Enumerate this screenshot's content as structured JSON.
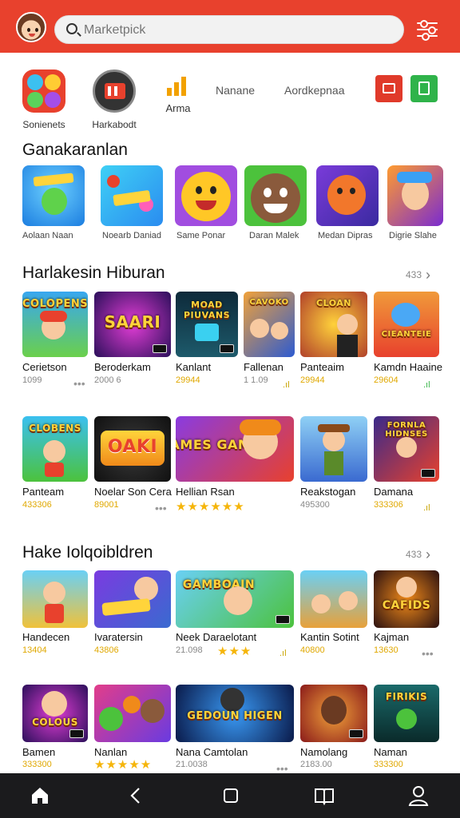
{
  "header": {
    "search_placeholder": "Marketpick"
  },
  "quick": {
    "cat1_label": "Sonienets",
    "cat2_label": "Harkabodt",
    "cat3_label": "Arma",
    "link1": "Nanane",
    "link2": "Aordkepnaa"
  },
  "favorites": {
    "title": "Ganakaranlan",
    "items": [
      {
        "label": "Aolaan Naan"
      },
      {
        "label": "Noearb Daniad"
      },
      {
        "label": "Same Ponar"
      },
      {
        "label": "Daran Malek"
      },
      {
        "label": "Medan Dipras"
      },
      {
        "label": "Digrie Slahe"
      }
    ]
  },
  "section1": {
    "title": "Harlakesin Hiburan",
    "more": "433",
    "row1": [
      {
        "name": "Cerietson",
        "meta": "1099"
      },
      {
        "name": "Beroderkam",
        "meta": "2000 6"
      },
      {
        "name": "Kanlant",
        "meta": "29944"
      },
      {
        "name": "Fallenan",
        "meta": "1 1.09"
      },
      {
        "name": "Panteaim",
        "meta": "29944"
      },
      {
        "name": "Kamdn Haaine",
        "meta": "29604"
      }
    ],
    "row2": [
      {
        "name": "Panteam",
        "meta": "433306"
      },
      {
        "name": "Noelar Son Cera",
        "meta": "89001"
      },
      {
        "name": "Hellian Rsan",
        "meta": ""
      },
      {
        "name": "Reakstogan",
        "meta": "495300"
      },
      {
        "name": "Damana",
        "meta": "333306"
      }
    ],
    "art_texts": {
      "a1": "COLOPENS",
      "a2": "SAARI",
      "a3": "MOAD PIUVANS",
      "a4": "CAVOKO",
      "a5": "CLOAN",
      "a6": "CIEANTEIE",
      "b1": "CLOBENS",
      "b2": "OAKI",
      "b3": "CAMES GAMES",
      "b5": "FORNLA HIDNSES"
    }
  },
  "section2": {
    "title": "Hake Iolqoibldren",
    "more": "433",
    "row1": [
      {
        "name": "Handecen",
        "meta": "13404"
      },
      {
        "name": "Ivaratersin",
        "meta": "43806"
      },
      {
        "name": "Neek Daraelotant",
        "meta": "21.098"
      },
      {
        "name": "Kantin Sotint",
        "meta": "40800"
      },
      {
        "name": "Kajman",
        "meta": "13630"
      }
    ],
    "row2": [
      {
        "name": "Bamen",
        "meta": "333300"
      },
      {
        "name": "Nanlan",
        "meta": ""
      },
      {
        "name": "Nana Camtolan",
        "meta": "21.0038"
      },
      {
        "name": "Namolang",
        "meta": "2183.00"
      },
      {
        "name": "Naman",
        "meta": "333300"
      }
    ],
    "art_texts": {
      "c3": "GAMBOAIN",
      "c5": "CAFIDS",
      "d1": "COLOUS",
      "d3": "GEDOUN HIGEN",
      "d5": "FIRIKIS"
    }
  },
  "colors": {
    "brand_red": "#e8412d",
    "nav_dark": "#1b1b1d",
    "star_gold": "#f5b50a"
  },
  "icons": [
    "search-icon",
    "filter-icon",
    "home-icon",
    "back-icon",
    "square-icon",
    "book-icon",
    "profile-icon"
  ]
}
